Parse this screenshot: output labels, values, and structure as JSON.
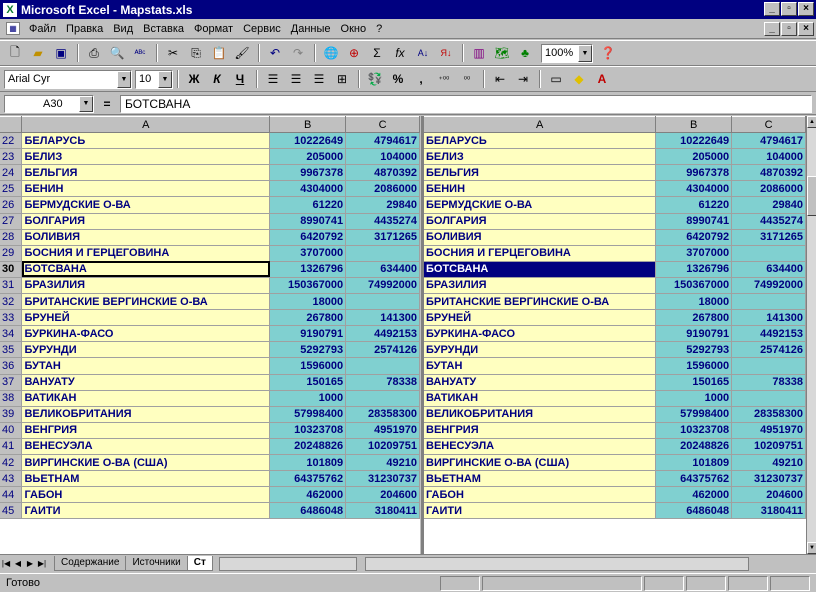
{
  "window": {
    "title": "Microsoft Excel - Mapstats.xls"
  },
  "menu": [
    "Файл",
    "Правка",
    "Вид",
    "Вставка",
    "Формат",
    "Сервис",
    "Данные",
    "Окно",
    "?"
  ],
  "toolbar": {
    "font_name": "Arial Cyr",
    "font_size": "10",
    "zoom": "100%"
  },
  "formula_bar": {
    "cell_ref": "A30",
    "content": "БОТСВАНА"
  },
  "columns": {
    "left": [
      "A",
      "B",
      "C"
    ],
    "right": [
      "A",
      "B",
      "C"
    ]
  },
  "rows": [
    {
      "n": "22",
      "a": "БЕЛАРУСЬ",
      "b": "10222649",
      "c_left": "4794617",
      "c_right": "4794617"
    },
    {
      "n": "23",
      "a": "БЕЛИЗ",
      "b": "205000",
      "c_left": "104000",
      "c_right": "104000"
    },
    {
      "n": "24",
      "a": "БЕЛЬГИЯ",
      "b": "9967378",
      "c_left": "4870392",
      "c_right": "4870392"
    },
    {
      "n": "25",
      "a": "БЕНИН",
      "b": "4304000",
      "c_left": "2086000",
      "c_right": "2086000"
    },
    {
      "n": "26",
      "a": "БЕРМУДСКИЕ О-ВА",
      "b": "61220",
      "c_left": "29840",
      "c_right": "29840"
    },
    {
      "n": "27",
      "a": "БОЛГАРИЯ",
      "b": "8990741",
      "c_left": "4435274",
      "c_right": "4435274"
    },
    {
      "n": "28",
      "a": "БОЛИВИЯ",
      "b": "6420792",
      "c_left": "3171265",
      "c_right": "3171265"
    },
    {
      "n": "29",
      "a": "БОСНИЯ И ГЕРЦЕГОВИНА",
      "b": "3707000",
      "c_left": "",
      "c_right": ""
    },
    {
      "n": "30",
      "a": "БОТСВАНА",
      "b": "1326796",
      "c_left": "634400",
      "c_right": "634400",
      "selected": true
    },
    {
      "n": "31",
      "a": "БРАЗИЛИЯ",
      "b": "150367000",
      "c_left": "74992000",
      "c_right": "74992000"
    },
    {
      "n": "32",
      "a": "БРИТАНСКИЕ ВЕРГИНСКИЕ О-ВА",
      "b": "18000",
      "c_left": "",
      "c_right": ""
    },
    {
      "n": "33",
      "a": "БРУНЕЙ",
      "b": "267800",
      "c_left": "141300",
      "c_right": "141300"
    },
    {
      "n": "34",
      "a": "БУРКИНА-ФАСО",
      "b": "9190791",
      "c_left": "4492153",
      "c_right": "4492153"
    },
    {
      "n": "35",
      "a": "БУРУНДИ",
      "b": "5292793",
      "c_left": "2574126",
      "c_right": "2574126"
    },
    {
      "n": "36",
      "a": "БУТАН",
      "b": "1596000",
      "c_left": "",
      "c_right": ""
    },
    {
      "n": "37",
      "a": "ВАНУАТУ",
      "b": "150165",
      "c_left": "78338",
      "c_right": "78338"
    },
    {
      "n": "38",
      "a": "ВАТИКАН",
      "b": "1000",
      "c_left": "",
      "c_right": ""
    },
    {
      "n": "39",
      "a": "ВЕЛИКОБРИТАНИЯ",
      "b": "57998400",
      "c_left": "28358300",
      "c_right": "28358300"
    },
    {
      "n": "40",
      "a": "ВЕНГРИЯ",
      "b": "10323708",
      "c_left": "4951970",
      "c_right": "4951970"
    },
    {
      "n": "41",
      "a": "ВЕНЕСУЭЛА",
      "b": "20248826",
      "c_left": "10209751",
      "c_right": "10209751"
    },
    {
      "n": "42",
      "a": "ВИРГИНСКИЕ О-ВА (США)",
      "b": "101809",
      "c_left": "49210",
      "c_right": "49210"
    },
    {
      "n": "43",
      "a": "ВЬЕТНАМ",
      "b": "64375762",
      "c_left": "31230737",
      "c_right": "31230737"
    },
    {
      "n": "44",
      "a": "ГАБОН",
      "b": "462000",
      "c_left": "204600",
      "c_right": "204600"
    },
    {
      "n": "45",
      "a": "ГАИТИ",
      "b": "6486048",
      "c_left": "3180411",
      "c_right": "3180411"
    }
  ],
  "tabs": [
    "Содержание",
    "Источники",
    "Ст"
  ],
  "status": {
    "text": "Готово"
  }
}
